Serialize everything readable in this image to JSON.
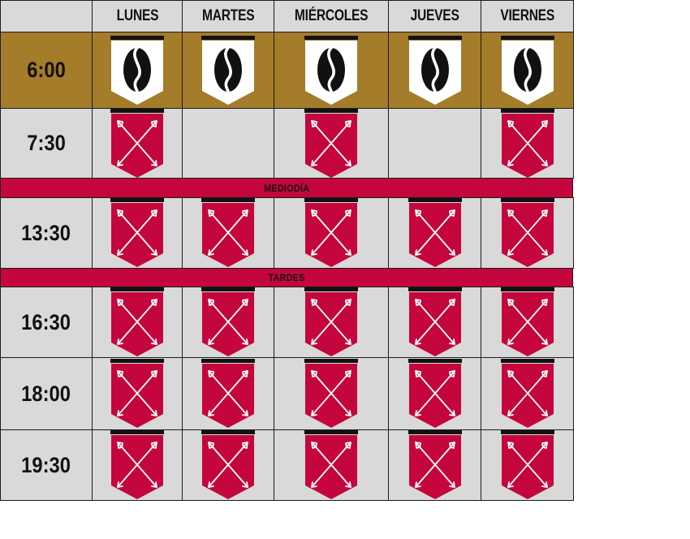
{
  "days": [
    "LUNES",
    "MARTES",
    "MIÉRCOLES",
    "JUEVES",
    "VIERNES"
  ],
  "rows": [
    {
      "time": "6:00",
      "row_style": "gold",
      "slots": [
        "coffee-badge-icon",
        "coffee-badge-icon",
        "coffee-badge-icon",
        "coffee-badge-icon",
        "coffee-badge-icon"
      ]
    },
    {
      "time": "7:30",
      "row_style": "grey",
      "slots": [
        "crossed-arrows-badge-icon",
        "",
        "crossed-arrows-badge-icon",
        "",
        "crossed-arrows-badge-icon"
      ]
    },
    {
      "band": "MEDIODÍA"
    },
    {
      "time": "13:30",
      "row_style": "grey",
      "slots": [
        "crossed-arrows-badge-icon",
        "crossed-arrows-badge-icon",
        "crossed-arrows-badge-icon",
        "crossed-arrows-badge-icon",
        "crossed-arrows-badge-icon"
      ]
    },
    {
      "band": "TARDES"
    },
    {
      "time": "16:30",
      "row_style": "grey",
      "slots": [
        "crossed-arrows-badge-icon",
        "crossed-arrows-badge-icon",
        "crossed-arrows-badge-icon",
        "crossed-arrows-badge-icon",
        "crossed-arrows-badge-icon"
      ]
    },
    {
      "time": "18:00",
      "row_style": "grey",
      "slots": [
        "crossed-arrows-badge-icon",
        "crossed-arrows-badge-icon",
        "crossed-arrows-badge-icon",
        "crossed-arrows-badge-icon",
        "crossed-arrows-badge-icon"
      ]
    },
    {
      "time": "19:30",
      "row_style": "grey",
      "slots": [
        "crossed-arrows-badge-icon",
        "crossed-arrows-badge-icon",
        "crossed-arrows-badge-icon",
        "crossed-arrows-badge-icon",
        "crossed-arrows-badge-icon"
      ]
    }
  ],
  "colors": {
    "gold_row": "#a47c2a",
    "grey_cell": "#d9d9d9",
    "accent_red": "#c4063c",
    "badge_white": "#ffffff",
    "ink": "#111111"
  }
}
